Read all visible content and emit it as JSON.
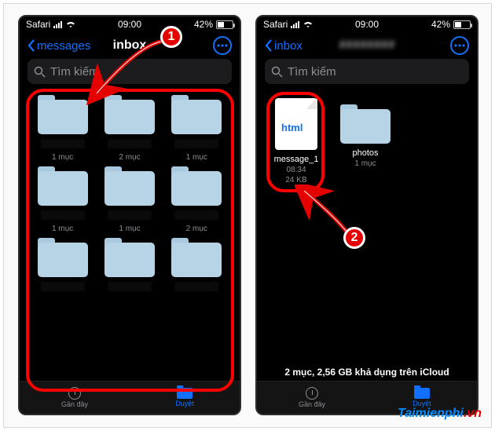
{
  "status": {
    "carrier": "Safari",
    "time": "09:00",
    "battery_pct": "42%"
  },
  "phone1": {
    "back_label": "messages",
    "title": "inbox",
    "search_placeholder": "Tìm kiếm",
    "tab_recent": "Gần đây",
    "tab_browse": "Duyệt",
    "folder_meta": [
      "1 mục",
      "2 mục",
      "1 mục",
      "1 mục",
      "1 mục",
      "2 mục",
      "",
      "",
      ""
    ]
  },
  "phone2": {
    "back_label": "inbox",
    "search_placeholder": "Tìm kiếm",
    "file_ext": "html",
    "file_name": "message_1",
    "file_time": "08:34",
    "file_size": "24 KB",
    "folder2_name": "photos",
    "folder2_meta": "1 mục",
    "storage_text": "2 mục, 2,56 GB khả dụng trên iCloud",
    "tab_recent": "Gần đây",
    "tab_browse": "Duyệt"
  },
  "callouts": {
    "c1": "1",
    "c2": "2"
  },
  "watermark": {
    "t1": "Taimienphi",
    "t2": ".vn"
  }
}
